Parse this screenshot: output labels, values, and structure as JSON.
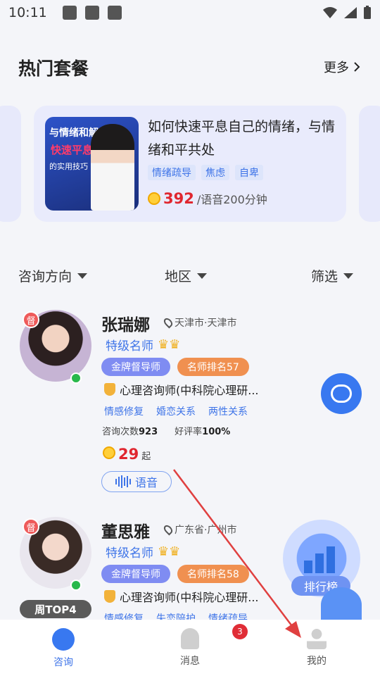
{
  "status_bar": {
    "time": "10:11"
  },
  "section": {
    "title": "热门套餐",
    "more": "更多"
  },
  "featured_card": {
    "thumb_line1": "与情绪和解",
    "thumb_line2": "快速平息",
    "thumb_line3": "的实用技巧",
    "title": "如何快速平息自己的情绪，与情绪和平共处",
    "tags": [
      "情绪疏导",
      "焦虑",
      "自卑"
    ],
    "price": "392",
    "unit": "/语音200分钟"
  },
  "filters": [
    "咨询方向",
    "地区",
    "筛选"
  ],
  "counselors": [
    {
      "badge": "督",
      "name": "张瑞娜",
      "location": "天津市·天津市",
      "level": "特级名师",
      "pills": [
        "金牌督导师",
        "名师排名57"
      ],
      "cert": "心理咨询师(中科院心理研...",
      "specialties": [
        "情感修复",
        "婚恋关系",
        "两性关系"
      ],
      "stats_count_label": "咨询次数",
      "stats_count": "923",
      "stats_rate_label": "好评率",
      "stats_rate": "100%",
      "price": "29",
      "price_suffix": "起",
      "voice": "语音"
    },
    {
      "badge": "督",
      "name": "董思雅",
      "location": "广东省·广州市",
      "level": "特级名师",
      "pills": [
        "金牌督导师",
        "名师排名58"
      ],
      "cert": "心理咨询师(中科院心理研...",
      "specialties": [
        "情感修复",
        "失恋陪护",
        "情绪疏导"
      ],
      "top_label": "周TOP4"
    }
  ],
  "rank_label": "排行榜",
  "nav": {
    "items": [
      {
        "label": "咨询"
      },
      {
        "label": "消息",
        "badge": "3"
      },
      {
        "label": "我的"
      }
    ]
  },
  "colors": {
    "accent": "#3e74e8",
    "price": "#e0262f",
    "online": "#28b84b"
  }
}
